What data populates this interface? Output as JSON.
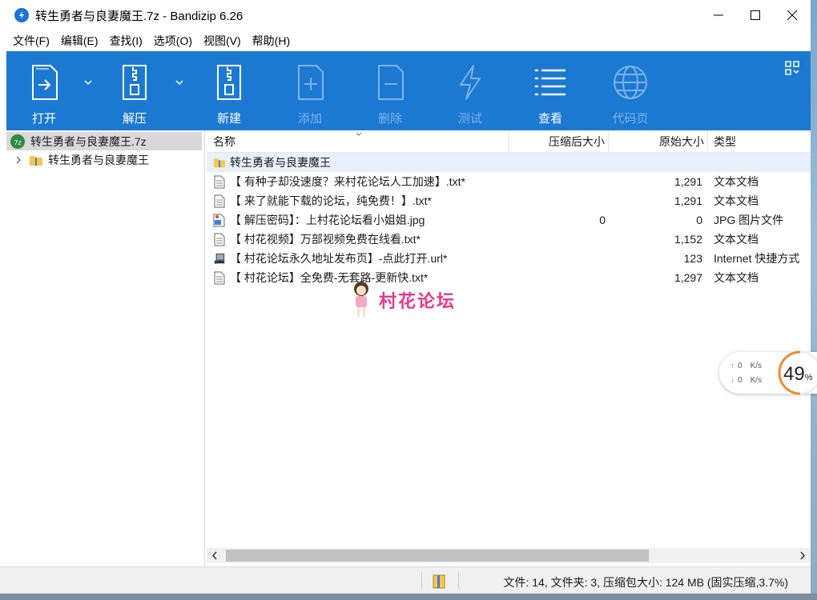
{
  "window": {
    "title": "转生勇者与良妻魔王.7z - Bandizip 6.26"
  },
  "menu": [
    "文件(F)",
    "编辑(E)",
    "查找(I)",
    "选项(O)",
    "视图(V)",
    "帮助(H)"
  ],
  "toolbar": {
    "items": [
      {
        "label": "打开",
        "icon": "open-archive-icon",
        "enabled": true
      },
      {
        "label": "解压",
        "icon": "extract-icon",
        "enabled": true
      },
      {
        "label": "新建",
        "icon": "new-archive-icon",
        "enabled": true
      },
      {
        "label": "添加",
        "icon": "add-file-icon",
        "enabled": false
      },
      {
        "label": "删除",
        "icon": "delete-file-icon",
        "enabled": false
      },
      {
        "label": "测试",
        "icon": "test-icon",
        "enabled": false
      },
      {
        "label": "查看",
        "icon": "view-list-icon",
        "enabled": true
      },
      {
        "label": "代码页",
        "icon": "codepage-globe-icon",
        "enabled": false
      }
    ],
    "accent": "#1c79d2"
  },
  "tree": {
    "root": "转生勇者与良妻魔王.7z",
    "child": "转生勇者与良妻魔王"
  },
  "columns": {
    "name": "名称",
    "packed": "压缩后大小",
    "original": "原始大小",
    "type": "类型"
  },
  "rows": [
    {
      "name": "转生勇者与良妻魔王",
      "packed": "",
      "original": "",
      "type": "",
      "kind": "folder"
    },
    {
      "name": "【 有种子却没速度？来村花论坛人工加速】.txt*",
      "packed": "",
      "original": "1,291",
      "type": "文本文档",
      "kind": "txt"
    },
    {
      "name": "【 来了就能下载的论坛，纯免费！】.txt*",
      "packed": "",
      "original": "1,291",
      "type": "文本文档",
      "kind": "txt"
    },
    {
      "name": "【 解压密码】：上村花论坛看小姐姐.jpg",
      "packed": "0",
      "original": "0",
      "type": "JPG 图片文件",
      "kind": "jpg"
    },
    {
      "name": "【 村花视频】万部视频免费在线看.txt*",
      "packed": "",
      "original": "1,152",
      "type": "文本文档",
      "kind": "txt"
    },
    {
      "name": "【 村花论坛永久地址发布页】-点此打开.url*",
      "packed": "",
      "original": "123",
      "type": "Internet 快捷方式",
      "kind": "url"
    },
    {
      "name": "【 村花论坛】全免费-无套路-更新快.txt*",
      "packed": "",
      "original": "1,297",
      "type": "文本文档",
      "kind": "txt"
    }
  ],
  "watermark": "村花论坛",
  "status": "文件: 14, 文件夹: 3, 压缩包大小: 124 MB (固实压缩,3.7%)",
  "speed": {
    "up": "0",
    "down": "0",
    "unit": "K/s",
    "percent": "49",
    "pct_sign": "%"
  }
}
